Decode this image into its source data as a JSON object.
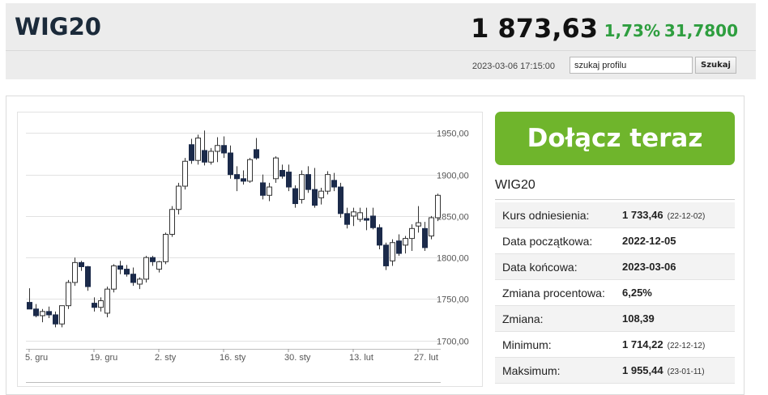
{
  "header": {
    "title": "WIG20",
    "price": "1 873,63",
    "change_pct": "1,73%",
    "change_value": "31,7800",
    "timestamp": "2023-03-06 17:15:00",
    "search_value": "szukaj profilu",
    "search_button": "Szukaj"
  },
  "cta": {
    "label": "Dołącz teraz",
    "color": "#6fb52c"
  },
  "info": {
    "title": "WIG20",
    "rows": [
      {
        "label": "Kurs odniesienia:",
        "value": "1 733,46",
        "date": "(22-12-02)"
      },
      {
        "label": "Data początkowa:",
        "value": "2022-12-05",
        "date": ""
      },
      {
        "label": "Data końcowa:",
        "value": "2023-03-06",
        "date": ""
      },
      {
        "label": "Zmiana procentowa:",
        "value": "6,25%",
        "date": ""
      },
      {
        "label": "Zmiana:",
        "value": "108,39",
        "date": ""
      },
      {
        "label": "Minimum:",
        "value": "1 714,22",
        "date": "(22-12-12)"
      },
      {
        "label": "Maksimum:",
        "value": "1 955,44",
        "date": "(23-01-11)"
      }
    ]
  },
  "chart_data": {
    "type": "candlestick",
    "x_ticks": [
      "5. gru",
      "19. gru",
      "2. sty",
      "16. sty",
      "30. sty",
      "13. lut",
      "27. lut"
    ],
    "x_tick_index": [
      0,
      10,
      20,
      30,
      40,
      50,
      60
    ],
    "y_ticks": [
      "1950,00",
      "1900,00",
      "1850,00",
      "1800,00",
      "1750,00",
      "1700,00"
    ],
    "y_tick_values": [
      1950,
      1900,
      1850,
      1800,
      1750,
      1700
    ],
    "ylim": [
      1690,
      1965
    ],
    "grid": true,
    "colors": {
      "up": "#ffffff",
      "down": "#1b2a4a",
      "outline": "#333333",
      "grid": "#e2e2e2"
    },
    "candles": [
      [
        1746,
        1763,
        1738,
        1738
      ],
      [
        1738,
        1744,
        1728,
        1730
      ],
      [
        1730,
        1738,
        1722,
        1735
      ],
      [
        1735,
        1741,
        1727,
        1731
      ],
      [
        1731,
        1735,
        1716,
        1720
      ],
      [
        1720,
        1742,
        1716,
        1742
      ],
      [
        1742,
        1773,
        1738,
        1770
      ],
      [
        1770,
        1800,
        1766,
        1794
      ],
      [
        1794,
        1796,
        1784,
        1789
      ],
      [
        1789,
        1790,
        1760,
        1765
      ],
      [
        1745,
        1752,
        1735,
        1740
      ],
      [
        1740,
        1752,
        1735,
        1748
      ],
      [
        1733,
        1765,
        1728,
        1762
      ],
      [
        1762,
        1792,
        1758,
        1790
      ],
      [
        1790,
        1796,
        1780,
        1786
      ],
      [
        1786,
        1791,
        1777,
        1780
      ],
      [
        1780,
        1788,
        1766,
        1770
      ],
      [
        1768,
        1776,
        1762,
        1774
      ],
      [
        1774,
        1802,
        1770,
        1800
      ],
      [
        1800,
        1802,
        1790,
        1795
      ],
      [
        1786,
        1796,
        1782,
        1795
      ],
      [
        1795,
        1830,
        1792,
        1828
      ],
      [
        1828,
        1862,
        1825,
        1858
      ],
      [
        1858,
        1890,
        1852,
        1886
      ],
      [
        1886,
        1920,
        1882,
        1916
      ],
      [
        1936,
        1943,
        1913,
        1917
      ],
      [
        1917,
        1948,
        1912,
        1944
      ],
      [
        1929,
        1953,
        1911,
        1915
      ],
      [
        1915,
        1932,
        1912,
        1928
      ],
      [
        1928,
        1945,
        1915,
        1935
      ],
      [
        1935,
        1946,
        1920,
        1926
      ],
      [
        1926,
        1935,
        1895,
        1900
      ],
      [
        1900,
        1910,
        1880,
        1895
      ],
      [
        1895,
        1905,
        1888,
        1892
      ],
      [
        1892,
        1920,
        1890,
        1918
      ],
      [
        1930,
        1944,
        1918,
        1920
      ],
      [
        1890,
        1900,
        1870,
        1875
      ],
      [
        1875,
        1890,
        1868,
        1885
      ],
      [
        1895,
        1922,
        1890,
        1920
      ],
      [
        1905,
        1912,
        1895,
        1898
      ],
      [
        1903,
        1912,
        1880,
        1885
      ],
      [
        1883,
        1887,
        1860,
        1865
      ],
      [
        1870,
        1905,
        1865,
        1900
      ],
      [
        1900,
        1910,
        1878,
        1882
      ],
      [
        1882,
        1908,
        1860,
        1863
      ],
      [
        1872,
        1884,
        1864,
        1880
      ],
      [
        1880,
        1904,
        1876,
        1900
      ],
      [
        1893,
        1902,
        1880,
        1885
      ],
      [
        1885,
        1890,
        1848,
        1853
      ],
      [
        1853,
        1860,
        1835,
        1840
      ],
      [
        1850,
        1860,
        1838,
        1855
      ],
      [
        1846,
        1860,
        1843,
        1854
      ],
      [
        1847,
        1860,
        1833,
        1845
      ],
      [
        1850,
        1860,
        1834,
        1836
      ],
      [
        1836,
        1840,
        1810,
        1815
      ],
      [
        1815,
        1818,
        1785,
        1790
      ],
      [
        1796,
        1822,
        1790,
        1818
      ],
      [
        1820,
        1828,
        1802,
        1805
      ],
      [
        1815,
        1826,
        1805,
        1823
      ],
      [
        1823,
        1840,
        1808,
        1835
      ],
      [
        1838,
        1862,
        1830,
        1842
      ],
      [
        1835,
        1843,
        1808,
        1812
      ],
      [
        1826,
        1850,
        1822,
        1848
      ],
      [
        1848,
        1877,
        1844,
        1875
      ]
    ]
  }
}
